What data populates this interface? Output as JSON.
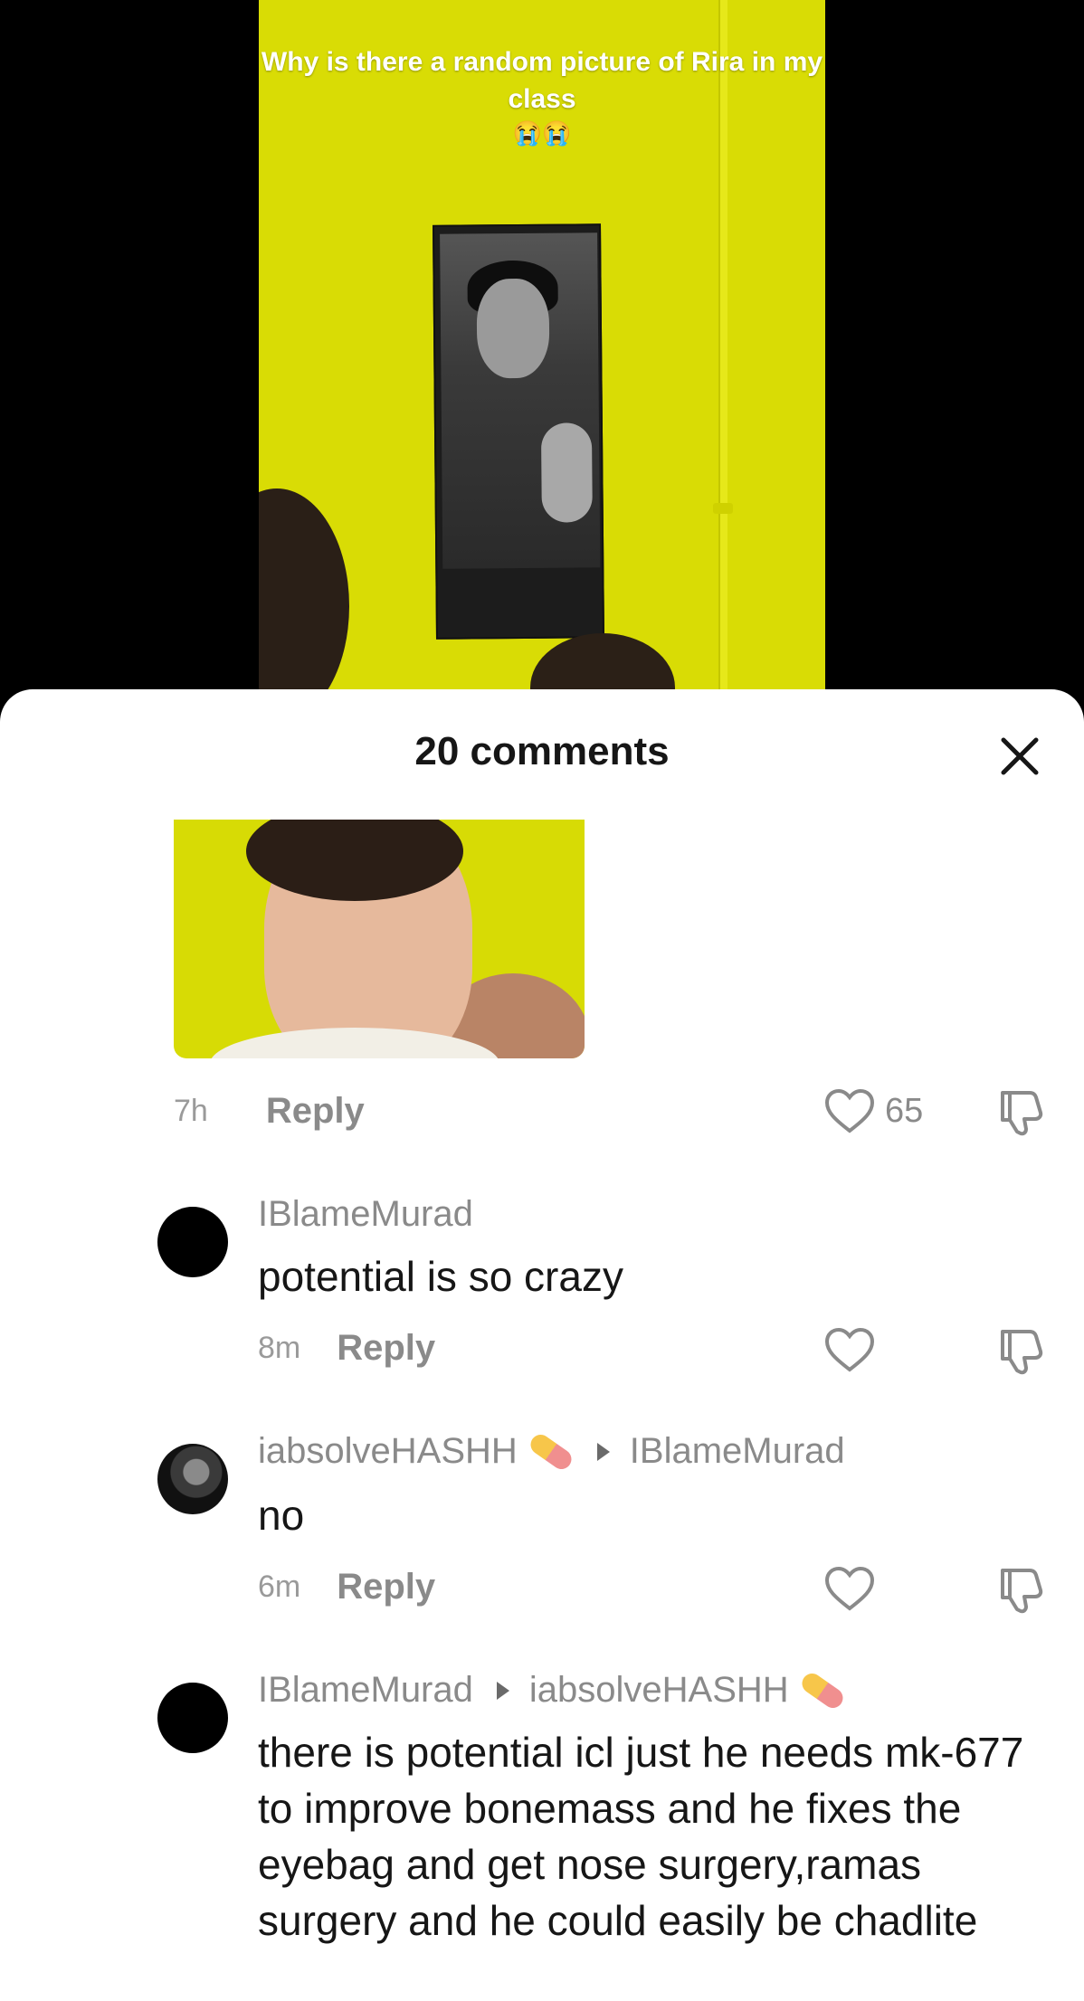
{
  "video": {
    "caption": "Why is there a random picture of Rira in my class",
    "caption_emoji": "😭😭"
  },
  "comments_sheet": {
    "title": "20 comments",
    "comments": [
      {
        "time": "7h",
        "reply_label": "Reply",
        "likes": "65"
      },
      {
        "username": "IBlameMurad",
        "text": "potential is so crazy",
        "time": "8m",
        "reply_label": "Reply"
      },
      {
        "username": "iabsolveHASHH",
        "reply_to": "IBlameMurad",
        "text": "no",
        "time": "6m",
        "reply_label": "Reply"
      },
      {
        "username": "IBlameMurad",
        "reply_to": "iabsolveHASHH",
        "text": "there is potential icl just he needs mk-677 to improve bonemass and he fixes the eyebag and get nose surgery,ramas surgery and he could easily be chadlite"
      }
    ]
  }
}
